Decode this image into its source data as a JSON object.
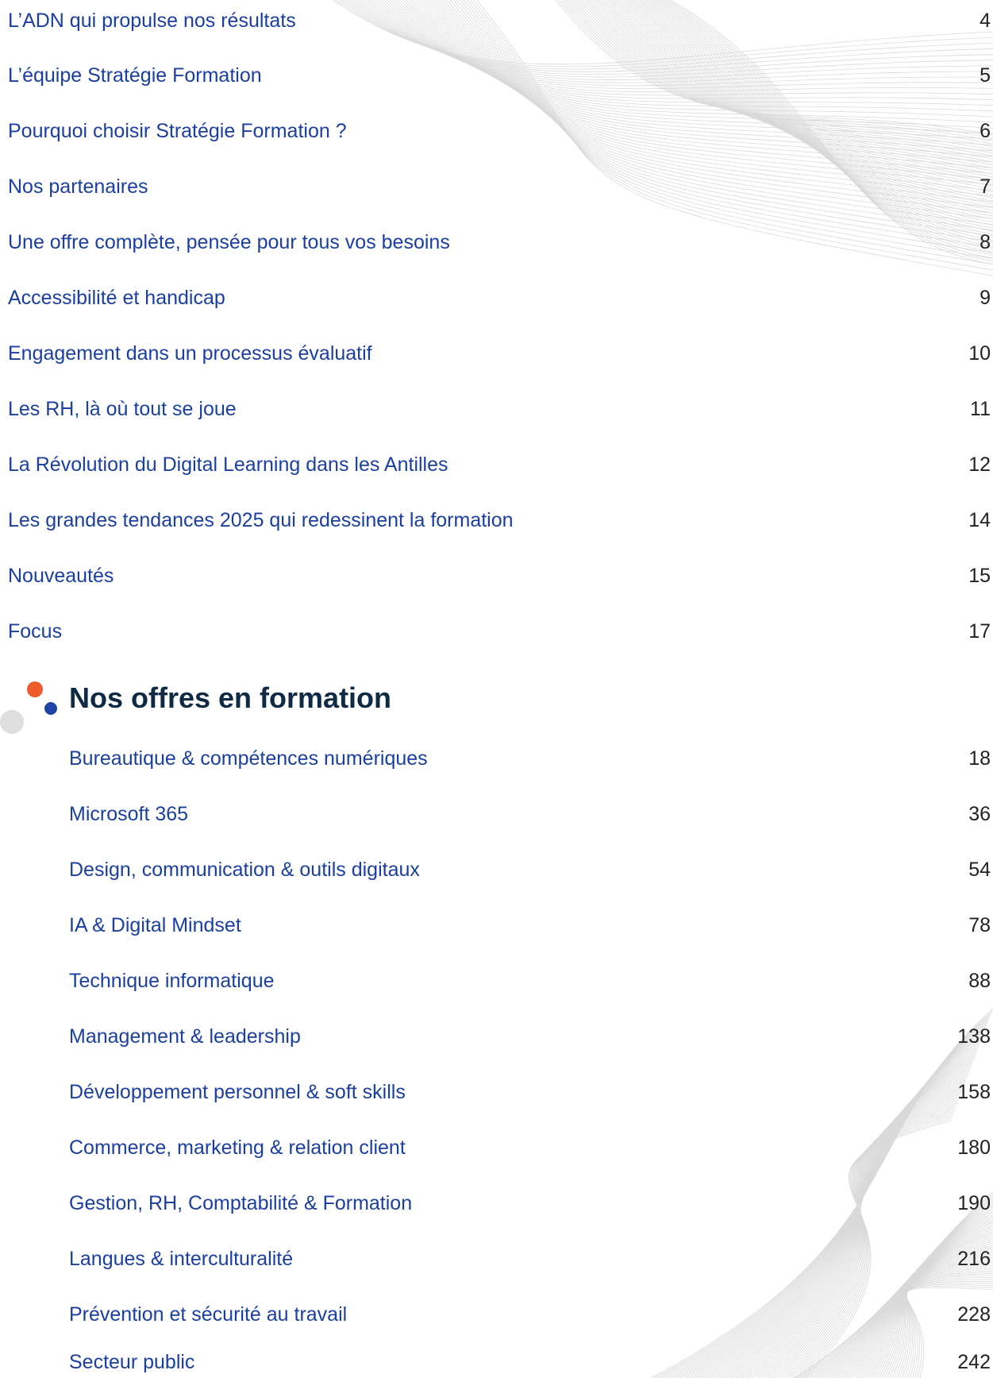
{
  "toc": {
    "main_items": [
      {
        "label": "L’ADN qui propulse nos résultats",
        "page": "4"
      },
      {
        "label": "L’équipe Stratégie Formation",
        "page": "5"
      },
      {
        "label": "Pourquoi choisir Stratégie Formation ?",
        "page": "6"
      },
      {
        "label": "Nos partenaires",
        "page": "7"
      },
      {
        "label": "Une offre complète, pensée pour tous vos besoins",
        "page": "8"
      },
      {
        "label": "Accessibilité et handicap",
        "page": "9"
      },
      {
        "label": "Engagement dans un processus évaluatif",
        "page": "10"
      },
      {
        "label": "Les RH, là où tout se joue",
        "page": "11"
      },
      {
        "label": "La Révolution du Digital Learning dans les Antilles",
        "page": "12"
      },
      {
        "label": "Les grandes tendances 2025 qui redessinent la formation",
        "page": "14"
      },
      {
        "label": "Nouveautés",
        "page": "15"
      },
      {
        "label": "Focus",
        "page": "17"
      }
    ],
    "section_heading": "Nos offres en formation",
    "sub_items": [
      {
        "label": "Bureautique & compétences numériques",
        "page": "18"
      },
      {
        "label": "Microsoft 365",
        "page": "36"
      },
      {
        "label": "Design, communication & outils digitaux",
        "page": "54"
      },
      {
        "label": "IA & Digital Mindset",
        "page": "78"
      },
      {
        "label": "Technique informatique",
        "page": "88"
      },
      {
        "label": "Management & leadership",
        "page": "138"
      },
      {
        "label": "Développement personnel & soft skills",
        "page": "158"
      },
      {
        "label": "Commerce, marketing & relation client",
        "page": "180"
      },
      {
        "label": "Gestion, RH, Comptabilité & Formation",
        "page": "190"
      },
      {
        "label": "Langues & interculturalité",
        "page": "216"
      },
      {
        "label": "Prévention et sécurité au travail",
        "page": "228"
      },
      {
        "label": "Secteur public",
        "page": "242"
      }
    ]
  },
  "colors": {
    "link": "#1a3fa0",
    "page_number": "#222222",
    "heading": "#0f2a44",
    "accent_orange": "#ef5b2a",
    "accent_blue": "#1f45a5",
    "accent_grey": "#dedede"
  }
}
